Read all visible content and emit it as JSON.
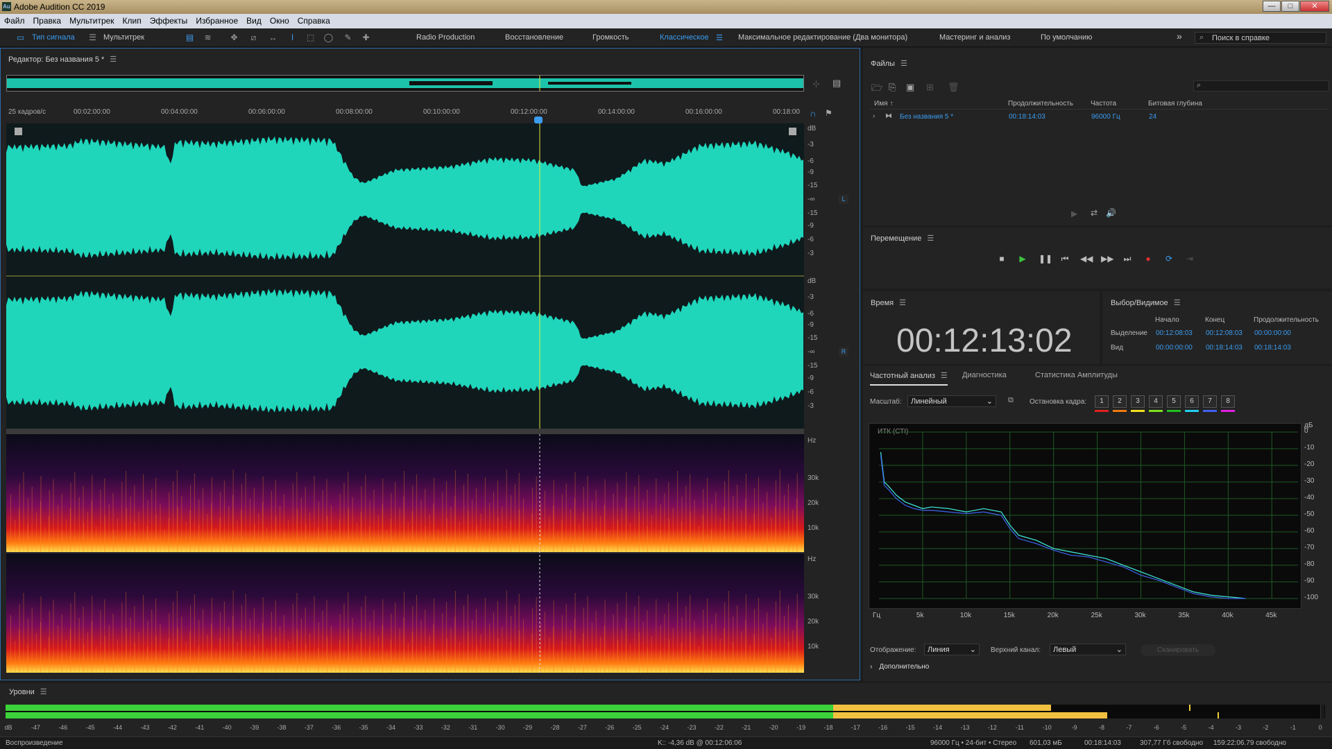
{
  "window": {
    "title": "Adobe Audition CC 2019",
    "minimize": "—",
    "maximize": "□",
    "close": "✕"
  },
  "menu": [
    "Файл",
    "Правка",
    "Мультитрек",
    "Клип",
    "Эффекты",
    "Избранное",
    "Вид",
    "Окно",
    "Справка"
  ],
  "toolbar": {
    "waveform": "Тип сигнала",
    "multitrack": "Мультитрек",
    "workspaces": [
      "Radio Production",
      "Восстановление",
      "Громкость",
      "Классическое",
      "Максимальное редактирование (Два монитора)",
      "Мастеринг и анализ",
      "По умолчанию"
    ],
    "active_workspace": "Классическое",
    "more": "»",
    "search_placeholder": "Поиск в справке"
  },
  "editor": {
    "title": "Редактор: Без названия 5 *",
    "timecode_format": "25 кадров/с",
    "ruler": [
      "00:02:00:00",
      "00:04:00:00",
      "00:06:00:00",
      "00:08:00:00",
      "00:10:00:00",
      "00:12:00:00",
      "00:14:00:00",
      "00:16:00:00",
      "00:18:00"
    ],
    "db_unit": "dB",
    "db_scale": [
      "-3",
      "-6",
      "-9",
      "-15",
      "-∞",
      "-15",
      "-9",
      "-6",
      "-3"
    ],
    "channel_left": "L",
    "channel_right": "R",
    "hz_unit": "Hz",
    "hz_scale": [
      "30k",
      "20k",
      "10k"
    ],
    "playhead_fraction": 0.6695
  },
  "files": {
    "title": "Файлы",
    "search_icon": "⌕",
    "columns": [
      "Имя",
      "Продолжительность",
      "Частота",
      "Битовая глубина"
    ],
    "sort_marker": "↑",
    "rows": [
      {
        "name": "Без названия 5 *",
        "duration": "00:18:14:03",
        "rate": "96000 Гц",
        "bits": "24"
      }
    ]
  },
  "transport": {
    "title": "Перемещение"
  },
  "time": {
    "title": "Время",
    "value": "00:12:13:02"
  },
  "selection": {
    "title": "Выбор/Видимое",
    "headers": [
      "Начало",
      "Конец",
      "Продолжительность"
    ],
    "rows": [
      {
        "label": "Выделение",
        "start": "00:12:08:03",
        "end": "00:12:08:03",
        "dur": "00:00:00:00"
      },
      {
        "label": "Вид",
        "start": "00:00:00:00",
        "end": "00:18:14:03",
        "dur": "00:18:14:03"
      }
    ]
  },
  "analysis": {
    "tabs": [
      "Частотный анализ",
      "Диагностика",
      "Статистика Амплитуды"
    ],
    "scale_label": "Масштаб:",
    "scale_value": "Линейный",
    "freeze_label": "Остановка кадра:",
    "frames": [
      "1",
      "2",
      "3",
      "4",
      "5",
      "6",
      "7",
      "8"
    ],
    "frame_colors": [
      "#e02020",
      "#f07a10",
      "#f0e020",
      "#80e020",
      "#20c020",
      "#20d0f0",
      "#4060f0",
      "#e020e0"
    ],
    "graph_label": "ИТК (СТI)",
    "display_label": "Отображение:",
    "display_value": "Линия",
    "top_channel_label": "Верхний канал:",
    "top_channel_value": "Левый",
    "scan_button": "Сканировать",
    "more": "Дополнительно"
  },
  "chart_data": {
    "type": "line",
    "x_unit": "Гц",
    "x_ticks": [
      "5k",
      "10k",
      "15k",
      "20k",
      "25k",
      "30k",
      "35k",
      "40k",
      "45k"
    ],
    "y_unit": "дБ",
    "y_ticks": [
      "0",
      "-10",
      "-20",
      "-30",
      "-40",
      "-50",
      "-60",
      "-70",
      "-80",
      "-90",
      "-100"
    ],
    "xlim": [
      0,
      48000
    ],
    "ylim": [
      -100,
      0
    ],
    "series": [
      {
        "color": "#3ee0d0",
        "x": [
          200,
          600,
          1000,
          2000,
          3000,
          4000,
          5000,
          6000,
          8000,
          10000,
          12000,
          14000,
          15000,
          16000,
          18000,
          20000,
          22000,
          24000,
          26000,
          28000,
          30000,
          32000,
          34000,
          36000,
          38000,
          40000,
          42000
        ],
        "y": [
          -12,
          -30,
          -32,
          -38,
          -42,
          -44,
          -46,
          -45,
          -46,
          -48,
          -46,
          -48,
          -56,
          -62,
          -65,
          -70,
          -72,
          -74,
          -76,
          -80,
          -84,
          -88,
          -92,
          -96,
          -98,
          -99,
          -100
        ]
      },
      {
        "color": "#3a60e0",
        "x": [
          200,
          600,
          1000,
          2000,
          3000,
          4000,
          5000,
          6000,
          8000,
          10000,
          12000,
          14000,
          15000,
          16000,
          18000,
          20000,
          22000,
          24000,
          26000,
          28000,
          30000,
          32000,
          34000,
          36000,
          38000,
          40000,
          42000
        ],
        "y": [
          -14,
          -32,
          -34,
          -40,
          -44,
          -46,
          -47,
          -47,
          -48,
          -49,
          -48,
          -50,
          -58,
          -64,
          -67,
          -71,
          -74,
          -75,
          -78,
          -81,
          -86,
          -89,
          -93,
          -97,
          -99,
          -100,
          -100
        ]
      }
    ]
  },
  "levels": {
    "title": "Уровни",
    "scale": [
      "dB",
      "-47",
      "-46",
      "-45",
      "-44",
      "-43",
      "-42",
      "-41",
      "-40",
      "-39",
      "-38",
      "-37",
      "-36",
      "-35",
      "-34",
      "-33",
      "-32",
      "-31",
      "-30",
      "-29",
      "-28",
      "-27",
      "-26",
      "-25",
      "-24",
      "-23",
      "-22",
      "-21",
      "-20",
      "-19",
      "-18",
      "-17",
      "-16",
      "-15",
      "-14",
      "-13",
      "-12",
      "-11",
      "-10",
      "-9",
      "-8",
      "-7",
      "-6",
      "-5",
      "-4",
      "-3",
      "-2",
      "-1",
      "0"
    ],
    "left_level_fraction": 0.795,
    "right_level_fraction": 0.838
  },
  "status": {
    "left": "Воспроизведение",
    "cursor": "K:: -4,36 dB @ 00:12:06:06",
    "format": "96000 Гц • 24-бит • Стерео",
    "size": "601,03 мБ",
    "duration": "00:18:14:03",
    "free": "307,77 Гб свободно",
    "free_time": "159:22:06.79 свободно"
  }
}
